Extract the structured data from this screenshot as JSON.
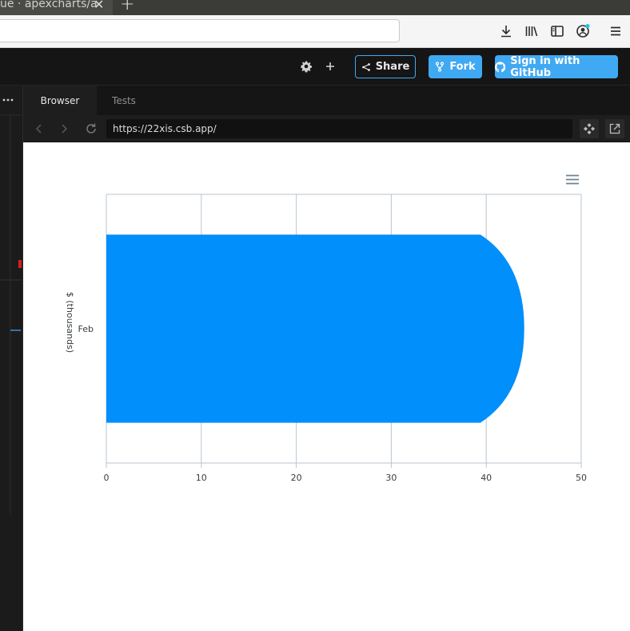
{
  "browser": {
    "tab_title": "ue · apexcharts/a",
    "close_glyph": "✕",
    "newtab_glyph": "+"
  },
  "header": {
    "share_label": "Share",
    "fork_label": "Fork",
    "github_label": "Sign in with GitHub"
  },
  "preview": {
    "tabs": [
      "Browser",
      "Tests"
    ],
    "url": "https://22xis.csb.app/"
  },
  "colors": {
    "accent": "#40a9f3",
    "bar": "#008ffb"
  },
  "chart_data": {
    "type": "bar",
    "orientation": "horizontal",
    "categories": [
      "Feb"
    ],
    "values": [
      44
    ],
    "ylabel": "$ (thousands)",
    "xlim": [
      0,
      50
    ],
    "xticks": [
      0,
      10,
      20,
      30,
      40,
      50
    ],
    "grid": true,
    "bar_end_shape": "rounded"
  }
}
